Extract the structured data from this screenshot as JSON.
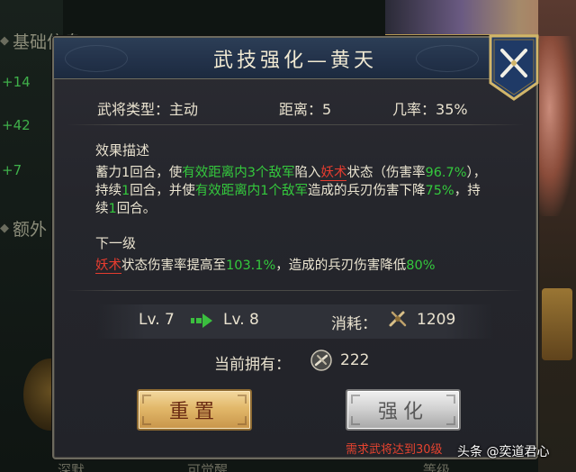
{
  "background": {
    "section_basic": "基础信息",
    "section_extra": "额外",
    "stats": [
      "+14",
      "+42",
      "+7"
    ],
    "bottom_labels": [
      "深默",
      "可觉醒",
      "等级"
    ]
  },
  "dialog": {
    "title": "武技强化—黄天",
    "info": {
      "type_label": "武将类型：",
      "type_value": "主动",
      "distance_label": "距离：",
      "distance_value": "5",
      "rate_label": "几率：",
      "rate_value": "35%"
    },
    "effect": {
      "heading": "效果描述",
      "parts": [
        {
          "text": "蓄力1回合，使",
          "color": "normal"
        },
        {
          "text": "有效距离内3个敌军",
          "color": "green"
        },
        {
          "text": "陷入",
          "color": "normal"
        },
        {
          "text": "妖术",
          "color": "red-underline"
        },
        {
          "text": "状态（伤害率",
          "color": "normal"
        },
        {
          "text": "96.7%",
          "color": "green"
        },
        {
          "text": "），持续",
          "color": "normal"
        },
        {
          "text": "1",
          "color": "green"
        },
        {
          "text": "回合，并使",
          "color": "normal"
        },
        {
          "text": "有效距离内1个敌军",
          "color": "green"
        },
        {
          "text": "造成的兵刃伤害下降",
          "color": "normal"
        },
        {
          "text": "75%",
          "color": "green"
        },
        {
          "text": "，持续",
          "color": "normal"
        },
        {
          "text": "1",
          "color": "green"
        },
        {
          "text": "回合。",
          "color": "normal"
        }
      ]
    },
    "next_level": {
      "heading": "下一级",
      "parts": [
        {
          "text": "妖术",
          "color": "red-underline"
        },
        {
          "text": "状态伤害率提高至",
          "color": "normal"
        },
        {
          "text": "103.1%",
          "color": "green"
        },
        {
          "text": "，造成的兵刃伤害降低",
          "color": "normal"
        },
        {
          "text": "80%",
          "color": "green"
        }
      ]
    },
    "level": {
      "from": "Lv. 7",
      "to": "Lv. 8",
      "cost_label": "消耗：",
      "cost_value": "1209"
    },
    "owned": {
      "label": "当前拥有：",
      "value": "222"
    },
    "buttons": {
      "reset": "重置",
      "enhance": "强化"
    },
    "requirement": "需求武将达到30级"
  },
  "watermark": "头条 @奕道君心",
  "colors": {
    "green": "#34c83d",
    "red": "#e53c2f",
    "title_bar": "#223149",
    "gold_button": "#e2b86a"
  },
  "icons": {
    "close": "crossed-blades-close-icon",
    "cost": "scroll-item-icon",
    "owned": "coin-item-icon",
    "arrow": "right-arrow-icon"
  }
}
